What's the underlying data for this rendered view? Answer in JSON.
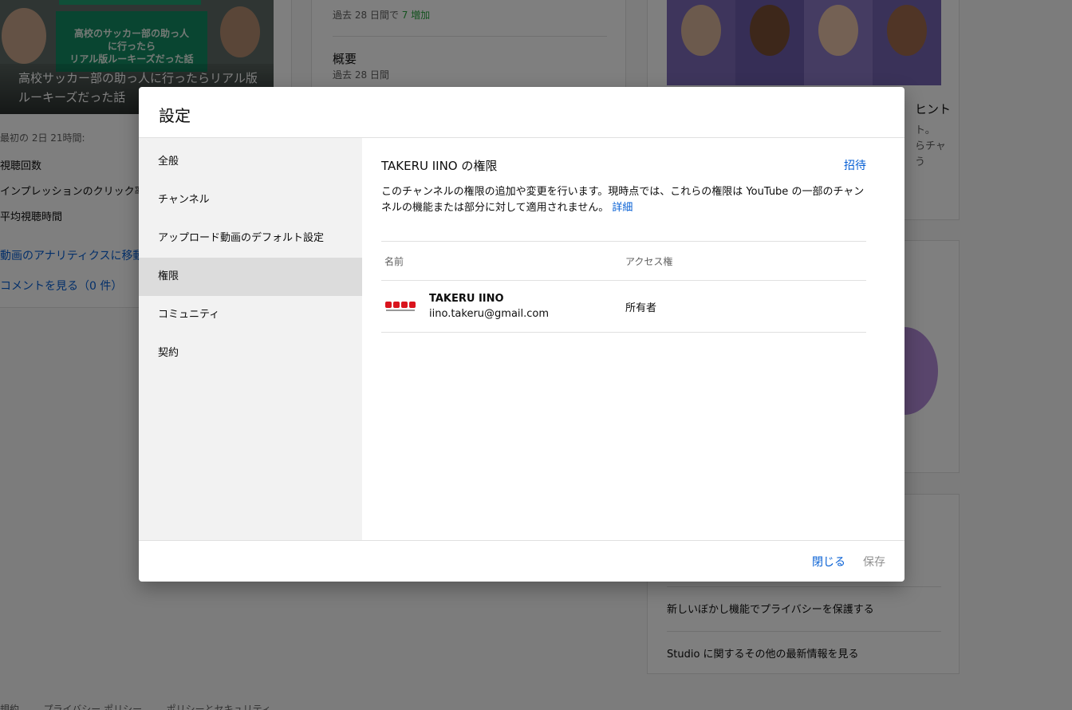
{
  "background": {
    "video": {
      "thumb_text": "高校のサッカー部の助っ人\nに行ったら\nリアル版ルーキーズだった話",
      "title": "高校サッカー部の助っ人に行ったらリアル版ルーキーズだった話",
      "period": "最初の 2日 21時間:",
      "stats": [
        "視聴回数",
        "インプレッションのクリック率",
        "平均視聴時間"
      ],
      "analytics_link": "動画のアナリティクスに移動",
      "comments_link": "コメントを見る（0 件）"
    },
    "summary": {
      "growth_prefix": "過去 28 日間で",
      "growth_value": "7 増加",
      "title": "概要",
      "period": "過去 28 日間"
    },
    "news": {
      "heading": "ヒント",
      "text": "ト。\nらチャ\nう",
      "items": [
        "新しいぼかし機能でプライバシーを保護する",
        "Studio に関するその他の最新情報を見る"
      ]
    },
    "footer": "規約        プライバシー ポリシー        ポリシーとセキュリティ"
  },
  "dialog": {
    "title": "設定",
    "nav": [
      {
        "label": "全般"
      },
      {
        "label": "チャンネル"
      },
      {
        "label": "アップロード動画のデフォルト設定"
      },
      {
        "label": "権限",
        "active": true
      },
      {
        "label": "コミュニティ"
      },
      {
        "label": "契約"
      }
    ],
    "permissions": {
      "title": "TAKERU IINO の権限",
      "invite_label": "招待",
      "description": "このチャンネルの権限の追加や変更を行います。現時点では、これらの権限は YouTube の一部のチャンネルの機能または部分に対して適用されません。",
      "more_link": "詳細",
      "columns": {
        "name": "名前",
        "access": "アクセス権"
      },
      "rows": [
        {
          "name": "TAKERU IINO",
          "email": "iino.takeru@gmail.com",
          "role": "所有者",
          "avatar_icon": "channel-logo-icon"
        }
      ]
    },
    "footer": {
      "close_label": "閉じる",
      "save_label": "保存"
    }
  },
  "colors": {
    "link": "#065fd4",
    "scrim": "rgba(0,0,0,0.5)",
    "logo_red": "#d9141d"
  }
}
